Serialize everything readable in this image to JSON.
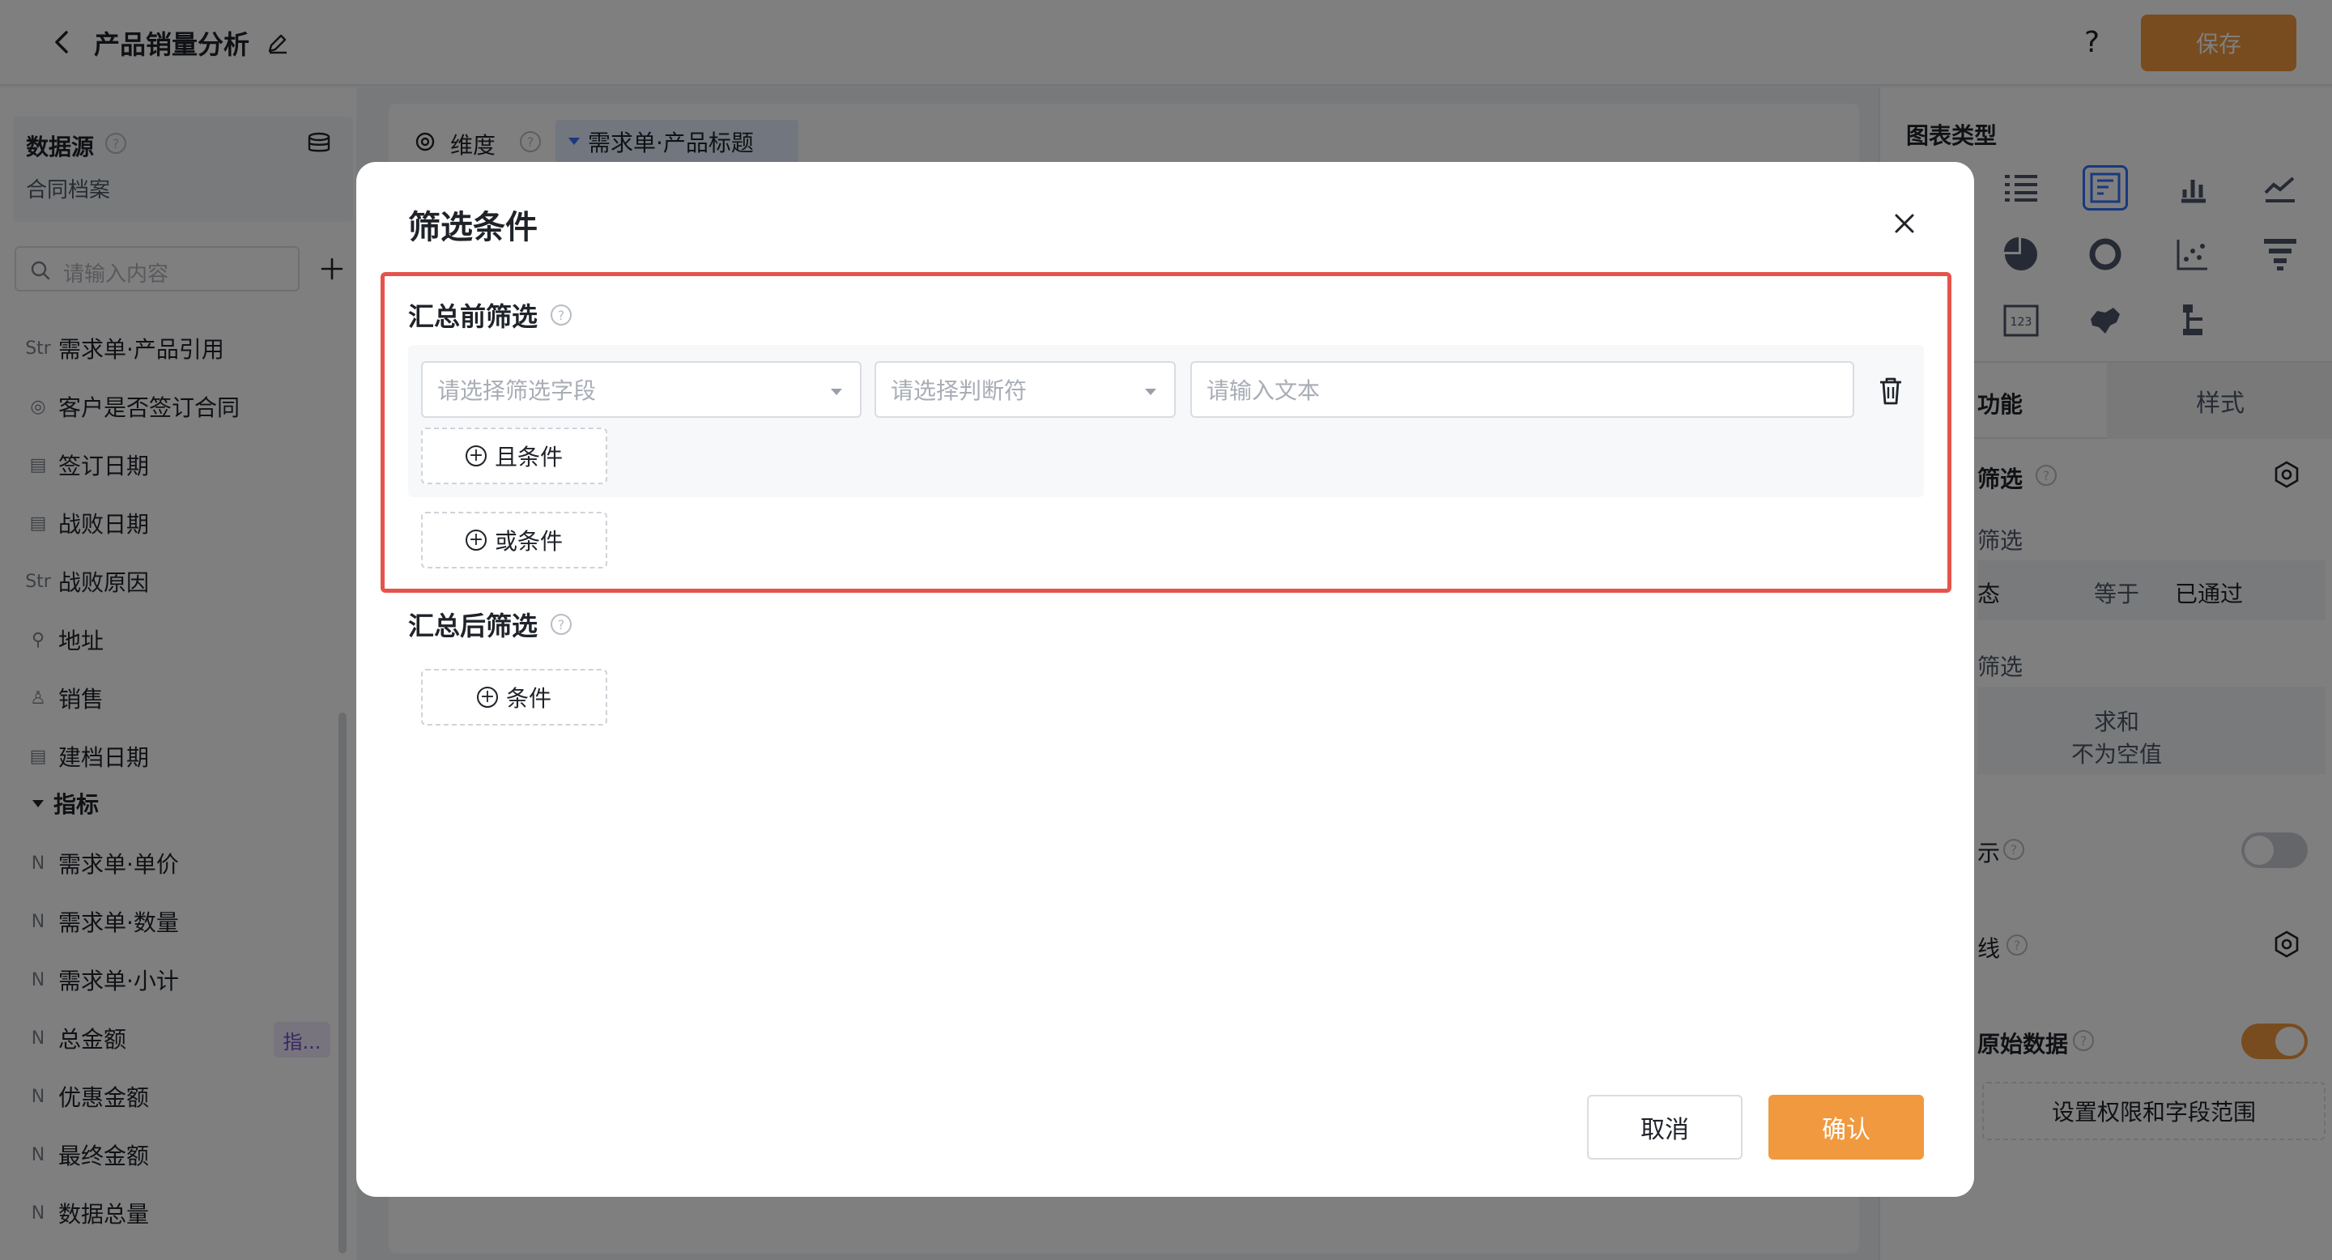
{
  "header": {
    "title": "产品销量分析",
    "help": "?",
    "save_label": "保存"
  },
  "left": {
    "datasource_label": "数据源",
    "datasource_name": "合同档案",
    "search_placeholder": "请输入内容",
    "fields": [
      {
        "type": "Str",
        "label": "需求单·产品引用"
      },
      {
        "type": "◎",
        "label": "客户是否签订合同"
      },
      {
        "type": "▤",
        "label": "签订日期"
      },
      {
        "type": "▤",
        "label": "战败日期"
      },
      {
        "type": "Str",
        "label": "战败原因"
      },
      {
        "type": "⚲",
        "label": "地址"
      },
      {
        "type": "♙",
        "label": "销售"
      },
      {
        "type": "▤",
        "label": "建档日期"
      }
    ],
    "metrics_group": "指标",
    "metrics": [
      {
        "type": "N",
        "label": "需求单·单价"
      },
      {
        "type": "N",
        "label": "需求单·数量"
      },
      {
        "type": "N",
        "label": "需求单·小计"
      },
      {
        "type": "N",
        "label": "总金额"
      },
      {
        "type": "N",
        "label": "优惠金额"
      },
      {
        "type": "N",
        "label": "最终金额"
      },
      {
        "type": "N",
        "label": "数据总量"
      }
    ],
    "metric_badge": "指..."
  },
  "center": {
    "dimension_label": "维度",
    "dimension_chip": "需求单·产品标题"
  },
  "right": {
    "chart_type_title": "图表类型",
    "tab_function": "功能",
    "tab_style": "样式",
    "filter_label": "筛选",
    "pre_filter": "筛选",
    "status_label": "态",
    "operator": "等于",
    "value": "已通过",
    "post_filter": "筛选",
    "agg_1": "求和",
    "agg_2": "不为空值",
    "show_label": "示",
    "line_label": "线",
    "raw_data_label": "原始数据",
    "permission_button": "设置权限和字段范围"
  },
  "dialog": {
    "title": "筛选条件",
    "pre_agg_title": "汇总前筛选",
    "field_placeholder": "请选择筛选字段",
    "operator_placeholder": "请选择判断符",
    "text_placeholder": "请输入文本",
    "and_condition": "且条件",
    "or_condition": "或条件",
    "post_agg_title": "汇总后筛选",
    "condition": "条件",
    "cancel": "取消",
    "confirm": "确认"
  },
  "colors": {
    "accent": "#f0993f",
    "highlight": "#e5534b",
    "primary_blue": "#3370ff"
  }
}
